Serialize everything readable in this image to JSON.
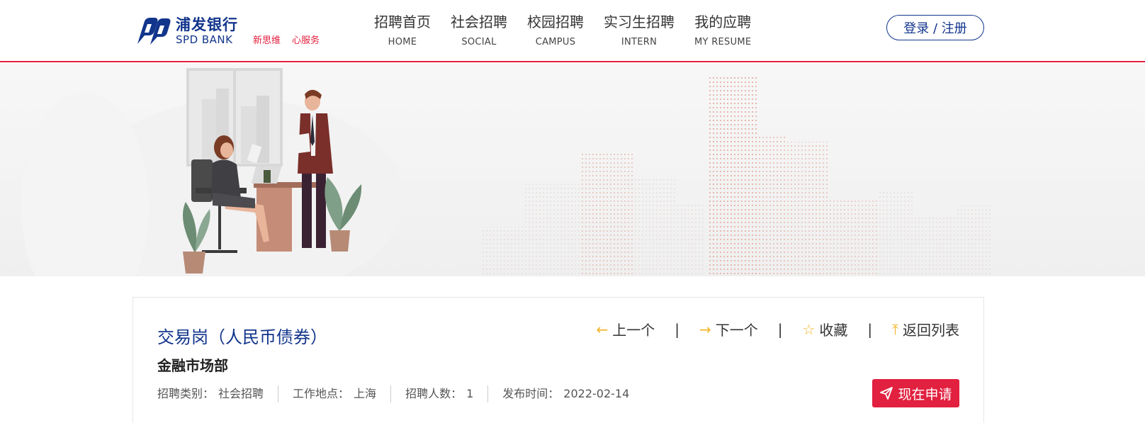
{
  "brand": {
    "name_cn": "浦发银行",
    "name_en": "SPD BANK",
    "slogans": [
      "新思维",
      "心服务"
    ],
    "color": "#12358c",
    "accent": "#e2203f"
  },
  "nav": {
    "items": [
      {
        "cn": "招聘首页",
        "en": "HOME"
      },
      {
        "cn": "社会招聘",
        "en": "SOCIAL"
      },
      {
        "cn": "校园招聘",
        "en": "CAMPUS"
      },
      {
        "cn": "实习生招聘",
        "en": "INTERN"
      },
      {
        "cn": "我的应聘",
        "en": "MY RESUME"
      }
    ]
  },
  "auth": {
    "login_label": "登录 / 注册"
  },
  "job": {
    "title": "交易岗（人民币债券）",
    "department": "金融市场部",
    "meta": [
      {
        "label": "招聘类别：",
        "value": "社会招聘"
      },
      {
        "label": "工作地点：",
        "value": "上海"
      },
      {
        "label": "招聘人数：",
        "value": "1"
      },
      {
        "label": "发布时间：",
        "value": "2022-02-14"
      }
    ]
  },
  "actions": {
    "prev": "上一个",
    "next": "下一个",
    "favorite": "收藏",
    "back": "返回列表",
    "separator": "|",
    "apply": "现在申请"
  },
  "icons": {
    "prev": "arrow-left-icon",
    "next": "arrow-right-icon",
    "favorite": "star-icon",
    "back": "arrow-up-icon",
    "apply": "paper-plane-icon"
  }
}
